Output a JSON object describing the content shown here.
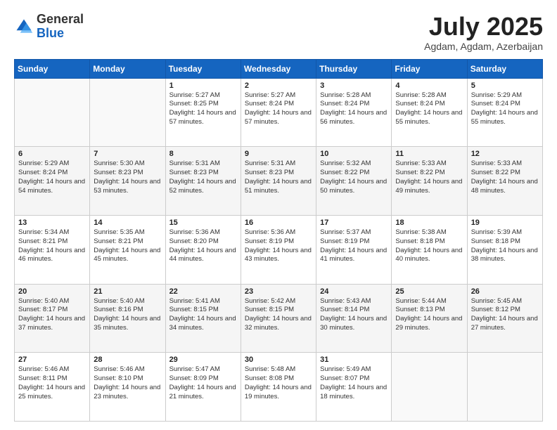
{
  "logo": {
    "general": "General",
    "blue": "Blue"
  },
  "header": {
    "month": "July 2025",
    "location": "Agdam, Agdam, Azerbaijan"
  },
  "days_of_week": [
    "Sunday",
    "Monday",
    "Tuesday",
    "Wednesday",
    "Thursday",
    "Friday",
    "Saturday"
  ],
  "weeks": [
    [
      {
        "day": "",
        "sunrise": "",
        "sunset": "",
        "daylight": ""
      },
      {
        "day": "",
        "sunrise": "",
        "sunset": "",
        "daylight": ""
      },
      {
        "day": "1",
        "sunrise": "Sunrise: 5:27 AM",
        "sunset": "Sunset: 8:25 PM",
        "daylight": "Daylight: 14 hours and 57 minutes."
      },
      {
        "day": "2",
        "sunrise": "Sunrise: 5:27 AM",
        "sunset": "Sunset: 8:24 PM",
        "daylight": "Daylight: 14 hours and 57 minutes."
      },
      {
        "day": "3",
        "sunrise": "Sunrise: 5:28 AM",
        "sunset": "Sunset: 8:24 PM",
        "daylight": "Daylight: 14 hours and 56 minutes."
      },
      {
        "day": "4",
        "sunrise": "Sunrise: 5:28 AM",
        "sunset": "Sunset: 8:24 PM",
        "daylight": "Daylight: 14 hours and 55 minutes."
      },
      {
        "day": "5",
        "sunrise": "Sunrise: 5:29 AM",
        "sunset": "Sunset: 8:24 PM",
        "daylight": "Daylight: 14 hours and 55 minutes."
      }
    ],
    [
      {
        "day": "6",
        "sunrise": "Sunrise: 5:29 AM",
        "sunset": "Sunset: 8:24 PM",
        "daylight": "Daylight: 14 hours and 54 minutes."
      },
      {
        "day": "7",
        "sunrise": "Sunrise: 5:30 AM",
        "sunset": "Sunset: 8:23 PM",
        "daylight": "Daylight: 14 hours and 53 minutes."
      },
      {
        "day": "8",
        "sunrise": "Sunrise: 5:31 AM",
        "sunset": "Sunset: 8:23 PM",
        "daylight": "Daylight: 14 hours and 52 minutes."
      },
      {
        "day": "9",
        "sunrise": "Sunrise: 5:31 AM",
        "sunset": "Sunset: 8:23 PM",
        "daylight": "Daylight: 14 hours and 51 minutes."
      },
      {
        "day": "10",
        "sunrise": "Sunrise: 5:32 AM",
        "sunset": "Sunset: 8:22 PM",
        "daylight": "Daylight: 14 hours and 50 minutes."
      },
      {
        "day": "11",
        "sunrise": "Sunrise: 5:33 AM",
        "sunset": "Sunset: 8:22 PM",
        "daylight": "Daylight: 14 hours and 49 minutes."
      },
      {
        "day": "12",
        "sunrise": "Sunrise: 5:33 AM",
        "sunset": "Sunset: 8:22 PM",
        "daylight": "Daylight: 14 hours and 48 minutes."
      }
    ],
    [
      {
        "day": "13",
        "sunrise": "Sunrise: 5:34 AM",
        "sunset": "Sunset: 8:21 PM",
        "daylight": "Daylight: 14 hours and 46 minutes."
      },
      {
        "day": "14",
        "sunrise": "Sunrise: 5:35 AM",
        "sunset": "Sunset: 8:21 PM",
        "daylight": "Daylight: 14 hours and 45 minutes."
      },
      {
        "day": "15",
        "sunrise": "Sunrise: 5:36 AM",
        "sunset": "Sunset: 8:20 PM",
        "daylight": "Daylight: 14 hours and 44 minutes."
      },
      {
        "day": "16",
        "sunrise": "Sunrise: 5:36 AM",
        "sunset": "Sunset: 8:19 PM",
        "daylight": "Daylight: 14 hours and 43 minutes."
      },
      {
        "day": "17",
        "sunrise": "Sunrise: 5:37 AM",
        "sunset": "Sunset: 8:19 PM",
        "daylight": "Daylight: 14 hours and 41 minutes."
      },
      {
        "day": "18",
        "sunrise": "Sunrise: 5:38 AM",
        "sunset": "Sunset: 8:18 PM",
        "daylight": "Daylight: 14 hours and 40 minutes."
      },
      {
        "day": "19",
        "sunrise": "Sunrise: 5:39 AM",
        "sunset": "Sunset: 8:18 PM",
        "daylight": "Daylight: 14 hours and 38 minutes."
      }
    ],
    [
      {
        "day": "20",
        "sunrise": "Sunrise: 5:40 AM",
        "sunset": "Sunset: 8:17 PM",
        "daylight": "Daylight: 14 hours and 37 minutes."
      },
      {
        "day": "21",
        "sunrise": "Sunrise: 5:40 AM",
        "sunset": "Sunset: 8:16 PM",
        "daylight": "Daylight: 14 hours and 35 minutes."
      },
      {
        "day": "22",
        "sunrise": "Sunrise: 5:41 AM",
        "sunset": "Sunset: 8:15 PM",
        "daylight": "Daylight: 14 hours and 34 minutes."
      },
      {
        "day": "23",
        "sunrise": "Sunrise: 5:42 AM",
        "sunset": "Sunset: 8:15 PM",
        "daylight": "Daylight: 14 hours and 32 minutes."
      },
      {
        "day": "24",
        "sunrise": "Sunrise: 5:43 AM",
        "sunset": "Sunset: 8:14 PM",
        "daylight": "Daylight: 14 hours and 30 minutes."
      },
      {
        "day": "25",
        "sunrise": "Sunrise: 5:44 AM",
        "sunset": "Sunset: 8:13 PM",
        "daylight": "Daylight: 14 hours and 29 minutes."
      },
      {
        "day": "26",
        "sunrise": "Sunrise: 5:45 AM",
        "sunset": "Sunset: 8:12 PM",
        "daylight": "Daylight: 14 hours and 27 minutes."
      }
    ],
    [
      {
        "day": "27",
        "sunrise": "Sunrise: 5:46 AM",
        "sunset": "Sunset: 8:11 PM",
        "daylight": "Daylight: 14 hours and 25 minutes."
      },
      {
        "day": "28",
        "sunrise": "Sunrise: 5:46 AM",
        "sunset": "Sunset: 8:10 PM",
        "daylight": "Daylight: 14 hours and 23 minutes."
      },
      {
        "day": "29",
        "sunrise": "Sunrise: 5:47 AM",
        "sunset": "Sunset: 8:09 PM",
        "daylight": "Daylight: 14 hours and 21 minutes."
      },
      {
        "day": "30",
        "sunrise": "Sunrise: 5:48 AM",
        "sunset": "Sunset: 8:08 PM",
        "daylight": "Daylight: 14 hours and 19 minutes."
      },
      {
        "day": "31",
        "sunrise": "Sunrise: 5:49 AM",
        "sunset": "Sunset: 8:07 PM",
        "daylight": "Daylight: 14 hours and 18 minutes."
      },
      {
        "day": "",
        "sunrise": "",
        "sunset": "",
        "daylight": ""
      },
      {
        "day": "",
        "sunrise": "",
        "sunset": "",
        "daylight": ""
      }
    ]
  ]
}
